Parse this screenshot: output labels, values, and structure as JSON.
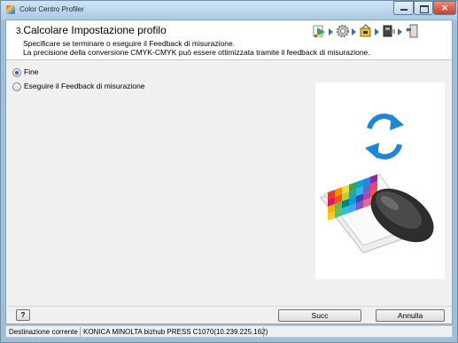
{
  "window": {
    "title": "Color Centro Profiler"
  },
  "header": {
    "step_number": "3.",
    "step_title": "Calcolare Impostazione profilo",
    "description_line1": "Specificare se terminare o eseguire il Feedback di misurazione.",
    "description_line2": "La precisione della conversione CMYK-CMYK può essere ottimizzata tramite il feedback di misurazione."
  },
  "options": [
    {
      "label": "Fine",
      "selected": true
    },
    {
      "label": "Eseguire il Feedback di misurazione",
      "selected": false
    }
  ],
  "footer": {
    "help_label": "?",
    "next_label": "Succ",
    "cancel_label": "Annulla"
  },
  "status_bar": {
    "label": "Destinazione corrente",
    "value": "KONICA MINOLTA bizhub PRESS C1070(10.239.225.162)"
  },
  "colors": {
    "accent": "#2a6fc0",
    "cycle_arrows": "#1f86d6"
  }
}
